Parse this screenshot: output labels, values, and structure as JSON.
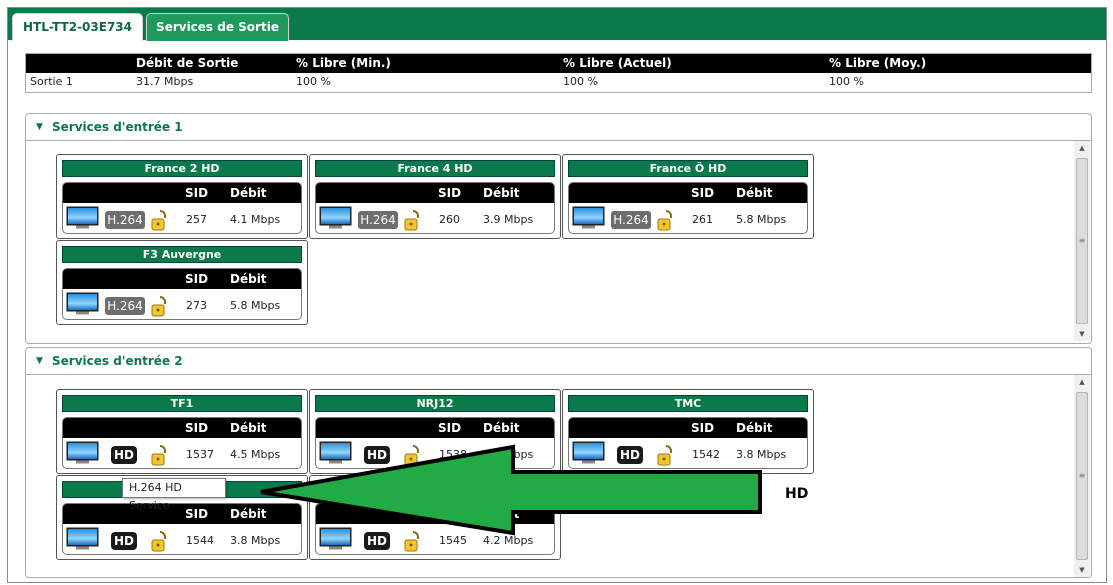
{
  "tabs": [
    {
      "label": "HTL-TT2-03E734"
    },
    {
      "label": "Services de Sortie"
    }
  ],
  "summary": {
    "headers": [
      "Débit de Sortie",
      "% Libre (Min.)",
      "% Libre (Actuel)",
      "% Libre (Moy.)"
    ],
    "row": {
      "name": "Sortie 1",
      "debit": "31.7 Mbps",
      "libre_min": "100 %",
      "libre_actuel": "100 %",
      "libre_moy": "100 %"
    }
  },
  "panels": [
    {
      "title": "Services d'entrée 1",
      "cards": [
        {
          "name": "France 2 HD",
          "codec": "H.264",
          "sid": "257",
          "debit": "4.1 Mbps"
        },
        {
          "name": "France 4 HD",
          "codec": "H.264",
          "sid": "260",
          "debit": "3.9 Mbps"
        },
        {
          "name": "France Ô HD",
          "codec": "H.264",
          "sid": "261",
          "debit": "5.8 Mbps"
        },
        {
          "name": "F3 Auvergne",
          "codec": "H.264",
          "sid": "273",
          "debit": "5.8 Mbps"
        }
      ]
    },
    {
      "title": "Services d'entrée 2",
      "cards": [
        {
          "name": "TF1",
          "codec": "HD",
          "sid": "1537",
          "debit": "4.5 Mbps"
        },
        {
          "name": "NRJ12",
          "codec": "HD",
          "sid": "1538",
          "debit": "4.0 Mbps"
        },
        {
          "name": "TMC",
          "codec": "HD",
          "sid": "1542",
          "debit": "3.8 Mbps"
        },
        {
          "name": "",
          "codec": "HD",
          "sid": "1544",
          "debit": "3.8 Mbps"
        },
        {
          "name": "",
          "codec": "HD",
          "sid": "1545",
          "debit": "4.2 Mbps"
        }
      ]
    }
  ],
  "card_headers": {
    "sid": "SID",
    "debit": "Débit"
  },
  "tooltip": "H.264 HD Service",
  "annotation": "HD",
  "colors": {
    "header_green": "#0a7a4a",
    "arrow_green": "#22aa44",
    "black": "#000000"
  }
}
